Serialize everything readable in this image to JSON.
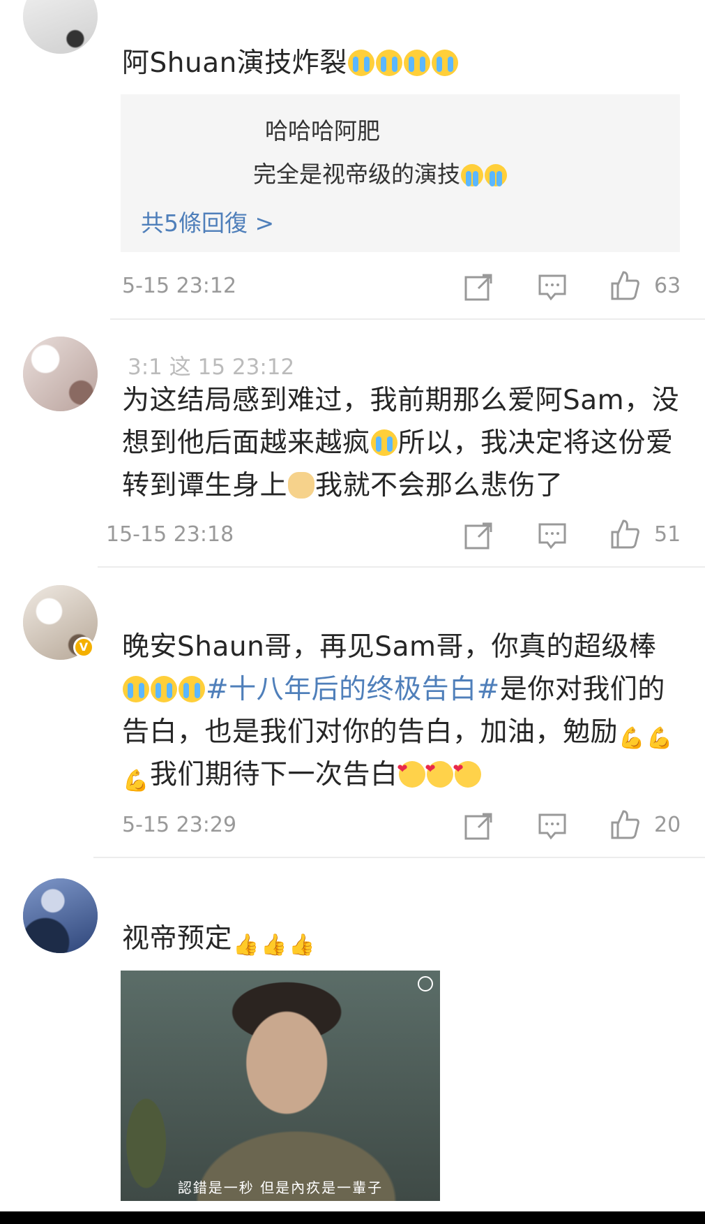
{
  "comments": [
    {
      "name": "",
      "text": "阿Shuan演技炸裂",
      "emojis": [
        "cry",
        "cry",
        "cry",
        "cry"
      ],
      "replies": [
        {
          "text": "哈哈哈阿肥"
        },
        {
          "text": "完全是视帝级的演技"
        }
      ],
      "more_replies": "共5條回復 >",
      "time": "5-15 23:12",
      "likes": "63"
    },
    {
      "name": "3:1 这 15 23:12",
      "text_parts": [
        "为这结局感到难过，我前期那么爱阿Sam，没想到他后面越来越疯",
        "所以，我决定将这份爱转到谭生身上",
        "我就不会那么悲伤了"
      ],
      "time": "15-15 23:18",
      "likes": "51"
    },
    {
      "name": "",
      "text_parts": [
        "晚安Shaun哥，再见Sam哥，你真的超级棒",
        "#十八年后的终极告白#",
        "是你对我们的告白，也是我们对你的告白，加油，勉励",
        "我们期待下一次告白"
      ],
      "time": "5-15 23:29",
      "likes": "20",
      "verified": "V"
    },
    {
      "name": "",
      "text": "视帝预定",
      "media_caption": "認錯是一秒 但是內疚是一輩子"
    }
  ],
  "icons": {
    "repost": "repost-icon",
    "comment": "comment-icon",
    "like": "like-icon"
  },
  "colors": {
    "link": "#4f7fba",
    "meta": "#999999",
    "verified": "#f4b000"
  }
}
